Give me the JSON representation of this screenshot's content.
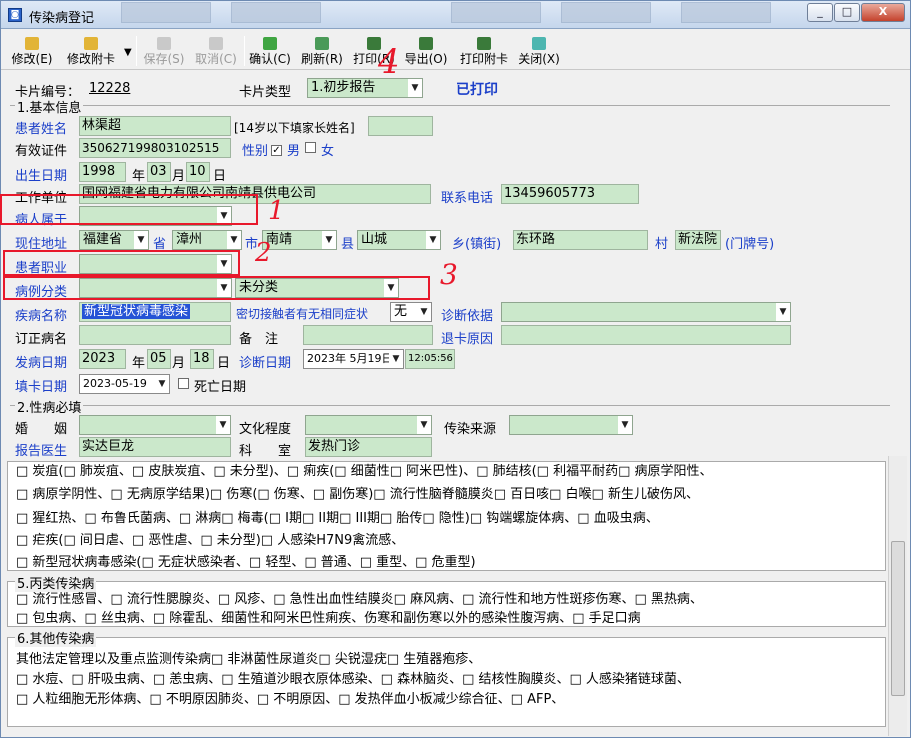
{
  "window": {
    "title": "传染病登记",
    "min": "_",
    "max": "□",
    "close": "X"
  },
  "toolbar": {
    "edit": "修改(E)",
    "edit_card": "修改附卡",
    "save": "保存(S)",
    "cancel": "取消(C)",
    "confirm": "确认(C)",
    "refresh": "刷新(R)",
    "print": "打印(R)",
    "export": "导出(O)",
    "print_card": "打印附卡",
    "close": "关闭(X)"
  },
  "card": {
    "no_label": "卡片编号：",
    "no": "12228",
    "type_label": "卡片类型",
    "type": "1.初步报告",
    "printed": "已打印"
  },
  "section1": "1.基本信息",
  "basic": {
    "patient_name_label": "患者姓名",
    "patient_name": "林渠超",
    "guardian_label": "[14岁以下填家长姓名]",
    "guardian": "",
    "id_label": "有效证件",
    "id": "350627199803102515",
    "gender_label": "性别",
    "male": "男",
    "female": "女",
    "birth_label": "出生日期",
    "birth_year": "1998",
    "year": "年",
    "birth_month": "03",
    "month": "月",
    "birth_day": "10",
    "day": "日",
    "work_label": "工作单位",
    "work": "国网福建省电力有限公司南靖县供电公司",
    "phone_label": "联系电话",
    "phone": "13459605773",
    "belong_label": "病人属于",
    "belong": "",
    "addr_label": "现住地址",
    "province": "福建省",
    "province_label": "省",
    "city": "漳州",
    "city_label": "市",
    "county": "南靖",
    "county_label": "县",
    "town": "山城",
    "town_label": "乡(镇街)",
    "village": "东环路",
    "village_label": "村",
    "doorplate": "新法院",
    "doorplate_label": "(门牌号)",
    "occupation_label": "患者职业",
    "occupation": "",
    "case_class_label": "病例分类",
    "case_class": "",
    "case_class2": "未分类",
    "disease_label": "疾病名称",
    "disease": "新型冠状病毒感染",
    "contact_label": "密切接触者有无相同症状",
    "contact": "无",
    "diag_basis_label": "诊断依据",
    "diag_basis": "",
    "revised_label": "订正病名",
    "revised": "",
    "note_label": "备　注",
    "note": "",
    "return_label": "退卡原因",
    "return": "",
    "onset_label": "发病日期",
    "onset_year": "2023",
    "onset_month": "05",
    "onset_day": "18",
    "diag_date_label": "诊断日期",
    "diag_date": "2023年 5月19日",
    "diag_time": "12:05:56",
    "fill_label": "填卡日期",
    "fill_date": "2023-05-19",
    "death_label": "死亡日期"
  },
  "section2": "2.性病必填",
  "std": {
    "marriage_label": "婚　　姻",
    "edu_label": "文化程度",
    "source_label": "传染来源",
    "doctor_label": "报告医生",
    "doctor": "实达巨龙",
    "dept_label": "科　　室",
    "dept": "发热门诊"
  },
  "classB_lines": [
    "□ 炭疽(□ 肺炭疽、□ 皮肤炭疽、□ 未分型)、□ 痢疾(□ 细菌性□ 阿米巴性)、□ 肺结核(□ 利福平耐药□ 病原学阳性、",
    "□ 病原学阴性、□ 无病原学结果)□ 伤寒(□ 伤寒、□ 副伤寒)□ 流行性脑脊髓膜炎□ 百日咳□ 白喉□ 新生儿破伤风、",
    "□ 猩红热、□ 布鲁氏菌病、□ 淋病□ 梅毒(□ I期□ II期□ III期□ 胎传□ 隐性)□ 钩端螺旋体病、□ 血吸虫病、",
    "□ 疟疾(□ 间日虐、□ 恶性虐、□ 未分型)□ 人感染H7N9禽流感、",
    "□ 新型冠状病毒感染(□ 无症状感染者、□ 轻型、□ 普通、□ 重型、□ 危重型)"
  ],
  "section5": "5.丙类传染病",
  "classC_lines": [
    "□ 流行性感冒、□ 流行性腮腺炎、□ 风疹、□ 急性出血性结膜炎□ 麻风病、□ 流行性和地方性斑疹伤寒、□ 黑热病、",
    "□ 包虫病、□ 丝虫病、□ 除霍乱、细菌性和阿米巴性痢疾、伤寒和副伤寒以外的感染性腹泻病、□ 手足口病"
  ],
  "section6": "6.其他传染病",
  "other_lines": [
    "其他法定管理以及重点监测传染病□ 非淋菌性尿道炎□ 尖锐湿疣□ 生殖器疱疹、",
    "□ 水痘、□ 肝吸虫病、□ 恙虫病、□ 生殖道沙眼衣原体感染、□ 森林脑炎、□ 结核性胸膜炎、□ 人感染猪链球菌、",
    "□ 人粒细胞无形体病、□ 不明原因肺炎、□ 不明原因、□ 发热伴血小板减少综合征、□ AFP、"
  ],
  "annotations": {
    "n1": "1",
    "n2": "2",
    "n3": "3",
    "n4": "4"
  },
  "colors": {
    "label_blue": "#1b3fc9",
    "field_green": "#cbe8cb",
    "annotation_red": "#e8182b"
  }
}
